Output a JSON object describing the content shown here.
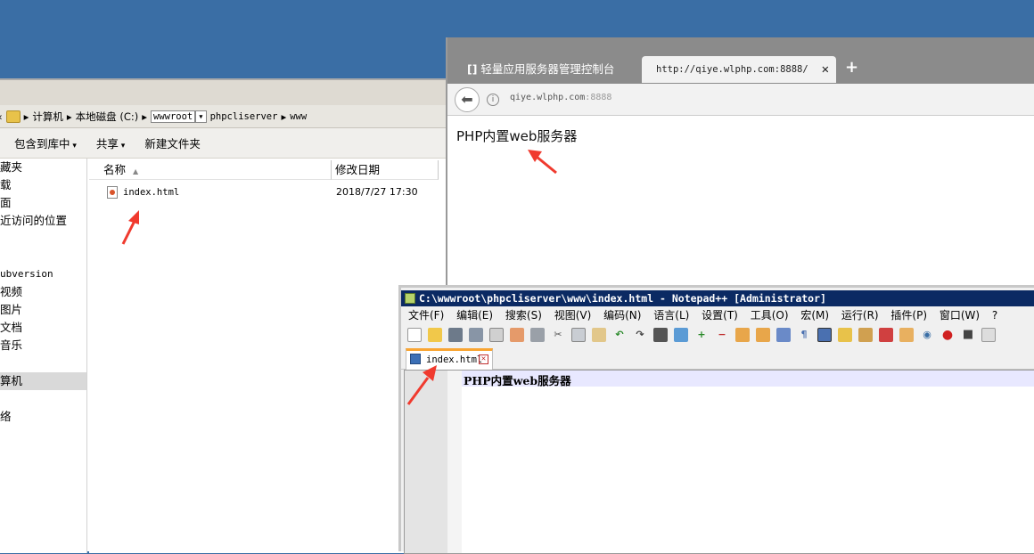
{
  "explorer": {
    "breadcrumb": [
      "计算机",
      "本地磁盘 (C:)",
      "wwwroot",
      "phpcliserver",
      "www"
    ],
    "commands": [
      "包含到库中",
      "共享",
      "新建文件夹"
    ],
    "nav_items": [
      "藏夹",
      "载",
      "面",
      "近访问的位置",
      "ubversion",
      "视频",
      "图片",
      "文档",
      "音乐",
      "算机",
      "络"
    ],
    "columns": {
      "name": "名称",
      "modified": "修改日期"
    },
    "files": [
      {
        "name": "index.html",
        "modified": "2018/7/27 17:30"
      }
    ]
  },
  "browser": {
    "tabs": [
      {
        "label": "轻量应用服务器管理控制台",
        "active": false
      },
      {
        "label": "http://qiye.wlphp.com:8888/",
        "active": true
      }
    ],
    "url_host": "qiye.wlphp.com",
    "url_port": ":8888",
    "page_text": "PHP内置web服务器"
  },
  "notepad": {
    "title": "C:\\wwwroot\\phpcliserver\\www\\index.html - Notepad++ [Administrator]",
    "menu": [
      "文件(F)",
      "编辑(E)",
      "搜索(S)",
      "视图(V)",
      "编码(N)",
      "语言(L)",
      "设置(T)",
      "工具(O)",
      "宏(M)",
      "运行(R)",
      "插件(P)",
      "窗口(W)",
      "?"
    ],
    "tab_label": "index.html",
    "code_line": "PHP内置web服务器"
  },
  "colors": {
    "desktop": "#3a6ea5",
    "annotation": "#f03a2e",
    "title_bar": "#0b2a63"
  }
}
